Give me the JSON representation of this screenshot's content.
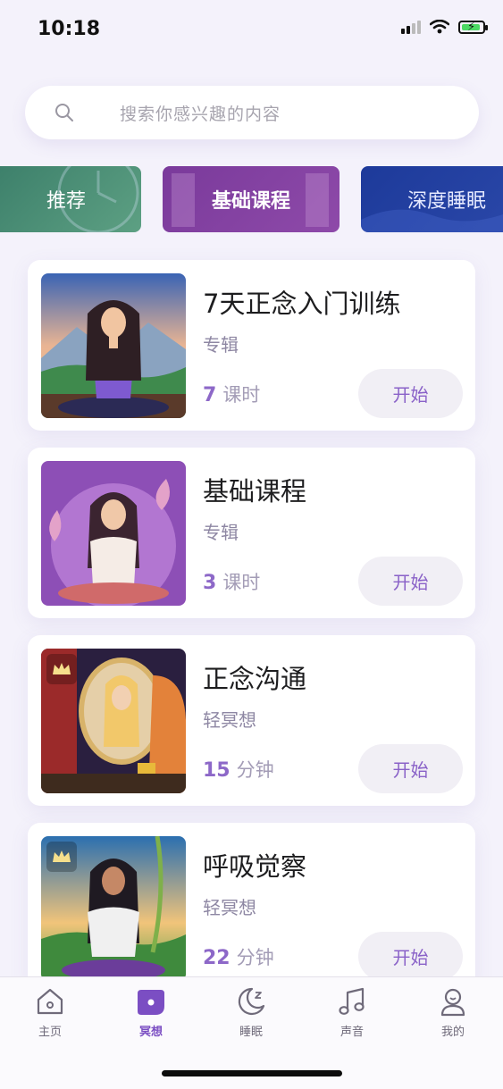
{
  "status": {
    "time": "10:18"
  },
  "search": {
    "placeholder": "搜索你感兴趣的内容"
  },
  "categories": [
    {
      "label": "推荐"
    },
    {
      "label": "基础课程"
    },
    {
      "label": "深度睡眠"
    }
  ],
  "courses": [
    {
      "title": "7天正念入门训练",
      "type": "专辑",
      "count": "7",
      "unit": "课时",
      "action": "开始",
      "premium": false
    },
    {
      "title": "基础课程",
      "type": "专辑",
      "count": "3",
      "unit": "课时",
      "action": "开始",
      "premium": false
    },
    {
      "title": "正念沟通",
      "type": "轻冥想",
      "count": "15",
      "unit": "分钟",
      "action": "开始",
      "premium": true
    },
    {
      "title": "呼吸觉察",
      "type": "轻冥想",
      "count": "22",
      "unit": "分钟",
      "action": "开始",
      "premium": true
    }
  ],
  "tabs": [
    {
      "label": "主页",
      "icon": "home-icon",
      "active": false
    },
    {
      "label": "冥想",
      "icon": "meditation-icon",
      "active": true
    },
    {
      "label": "睡眠",
      "icon": "moon-icon",
      "active": false
    },
    {
      "label": "声音",
      "icon": "music-note-icon",
      "active": false
    },
    {
      "label": "我的",
      "icon": "profile-icon",
      "active": false
    }
  ],
  "colors": {
    "accent": "#8a62c8",
    "background": "#f4f2fb"
  }
}
